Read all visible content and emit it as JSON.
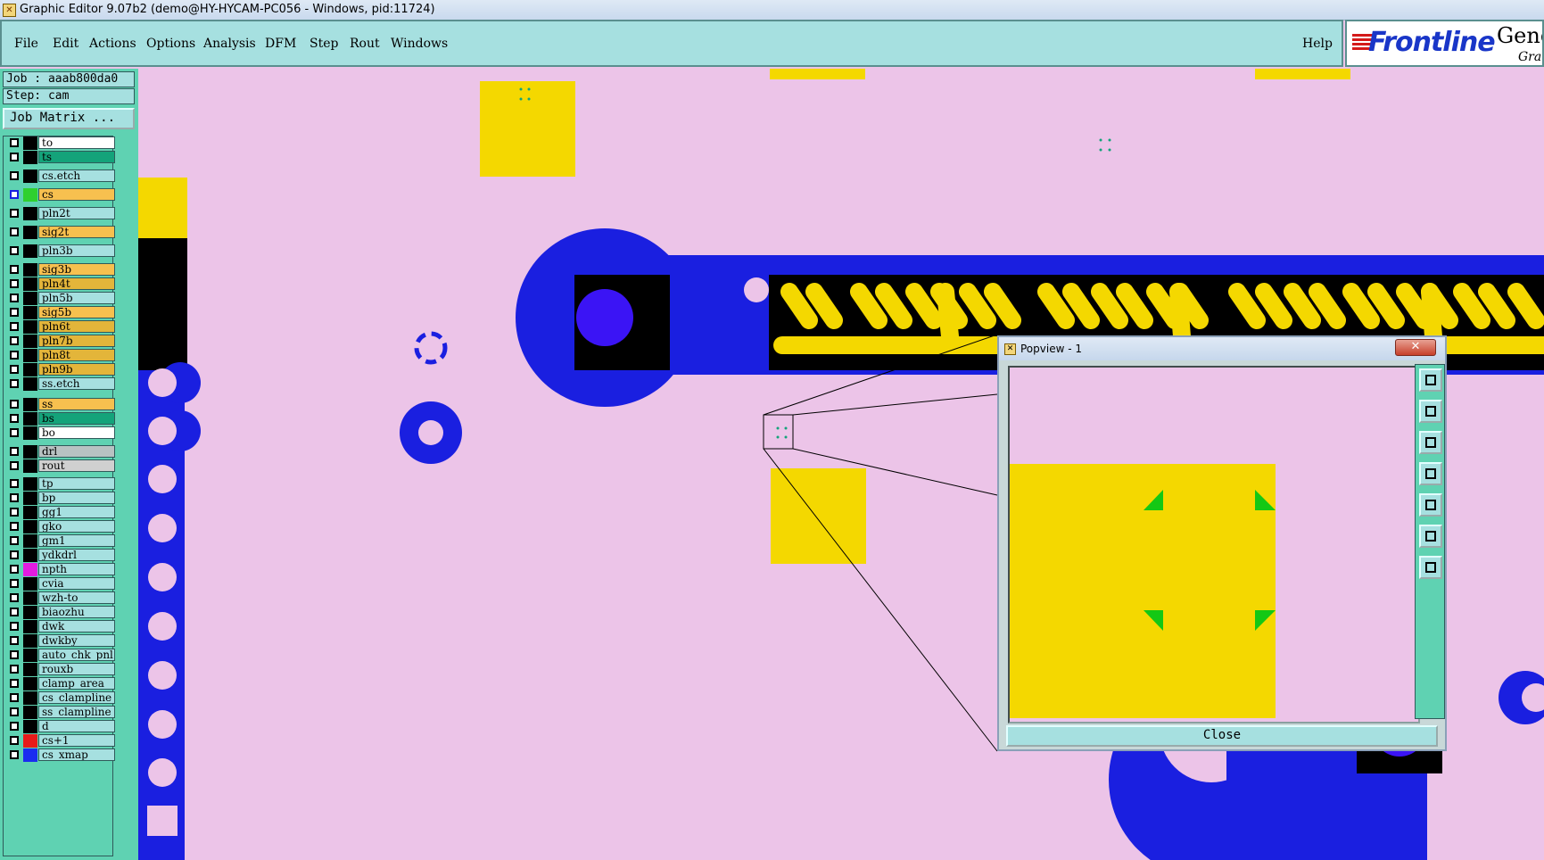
{
  "window": {
    "title": "Graphic Editor 9.07b2 (demo@HY-HYCAM-PC056 - Windows, pid:11724)"
  },
  "menu": {
    "items": [
      "File",
      "Edit",
      "Actions",
      "Options",
      "Analysis",
      "DFM",
      "Step",
      "Rout",
      "Windows"
    ],
    "help": "Help"
  },
  "brand": {
    "logo": "Frontline",
    "product": "Gene",
    "subtitle": "Grap"
  },
  "job": {
    "job_line": "Job : aaab800da0",
    "step_line": "Step: cam",
    "matrix_button": "Job Matrix ..."
  },
  "layers": [
    {
      "name": "to",
      "color": "#ffffff"
    },
    {
      "name": "ts",
      "color": "#14a37a"
    },
    {
      "name": "cs.etch",
      "color": "#a6e0e0"
    },
    {
      "name": "cs",
      "color": "#f7c04f",
      "active": true
    },
    {
      "name": "pln2t",
      "color": "#a6e0e0"
    },
    {
      "name": "sig2t",
      "color": "#f7c04f"
    },
    {
      "name": "pln3b",
      "color": "#a6e0e0"
    },
    {
      "name": "sig3b",
      "color": "#f7c04f"
    },
    {
      "name": "pln4t",
      "color": "#e3b53a"
    },
    {
      "name": "pln5b",
      "color": "#a6e0e0"
    },
    {
      "name": "sig5b",
      "color": "#f7c04f"
    },
    {
      "name": "pln6t",
      "color": "#e3b53a"
    },
    {
      "name": "pln7b",
      "color": "#e3b53a"
    },
    {
      "name": "pln8t",
      "color": "#e3b53a"
    },
    {
      "name": "pln9b",
      "color": "#e3b53a"
    },
    {
      "name": "ss.etch",
      "color": "#a6e0e0"
    },
    {
      "name": "ss",
      "color": "#f7c04f"
    },
    {
      "name": "bs",
      "color": "#14a37a"
    },
    {
      "name": "bo",
      "color": "#ffffff"
    },
    {
      "name": "drl",
      "color": "#b8c2c2"
    },
    {
      "name": "rout",
      "color": "#d0d0d0"
    },
    {
      "name": "tp",
      "color": "#a6e0e0"
    },
    {
      "name": "bp",
      "color": "#a6e0e0"
    },
    {
      "name": "gg1",
      "color": "#a6e0e0"
    },
    {
      "name": "gko",
      "color": "#a6e0e0"
    },
    {
      "name": "gm1",
      "color": "#a6e0e0"
    },
    {
      "name": "ydkdrl",
      "color": "#a6e0e0"
    },
    {
      "name": "npth",
      "color": "#a6e0e0",
      "swatch": "#e21ce0"
    },
    {
      "name": "cvia",
      "color": "#a6e0e0"
    },
    {
      "name": "wzh-to",
      "color": "#a6e0e0"
    },
    {
      "name": "biaozhu",
      "color": "#a6e0e0"
    },
    {
      "name": "dwk",
      "color": "#a6e0e0"
    },
    {
      "name": "dwkby",
      "color": "#a6e0e0"
    },
    {
      "name": "auto_chk_pnl",
      "color": "#a6e0e0"
    },
    {
      "name": "rouxb",
      "color": "#a6e0e0"
    },
    {
      "name": "clamp_area",
      "color": "#a6e0e0"
    },
    {
      "name": "cs_clampline",
      "color": "#a6e0e0"
    },
    {
      "name": "ss_clampline",
      "color": "#a6e0e0"
    },
    {
      "name": "d",
      "color": "#a6e0e0"
    },
    {
      "name": "cs+1",
      "color": "#a6e0e0",
      "swatch": "#e81a1a"
    },
    {
      "name": "cs_xmap",
      "color": "#a6e0e0",
      "swatch": "#1a2cf0"
    }
  ],
  "popview": {
    "title": "Popview - 1",
    "close_x": "✕",
    "close_button": "Close"
  },
  "colors": {
    "background": "#ecc4e8",
    "copper_blue": "#1a1fe0",
    "pad_yellow": "#f4d800",
    "drill_violet": "#3b14f5",
    "panel_teal": "#5fd2b2",
    "menu_cyan": "#a6e0e0"
  }
}
